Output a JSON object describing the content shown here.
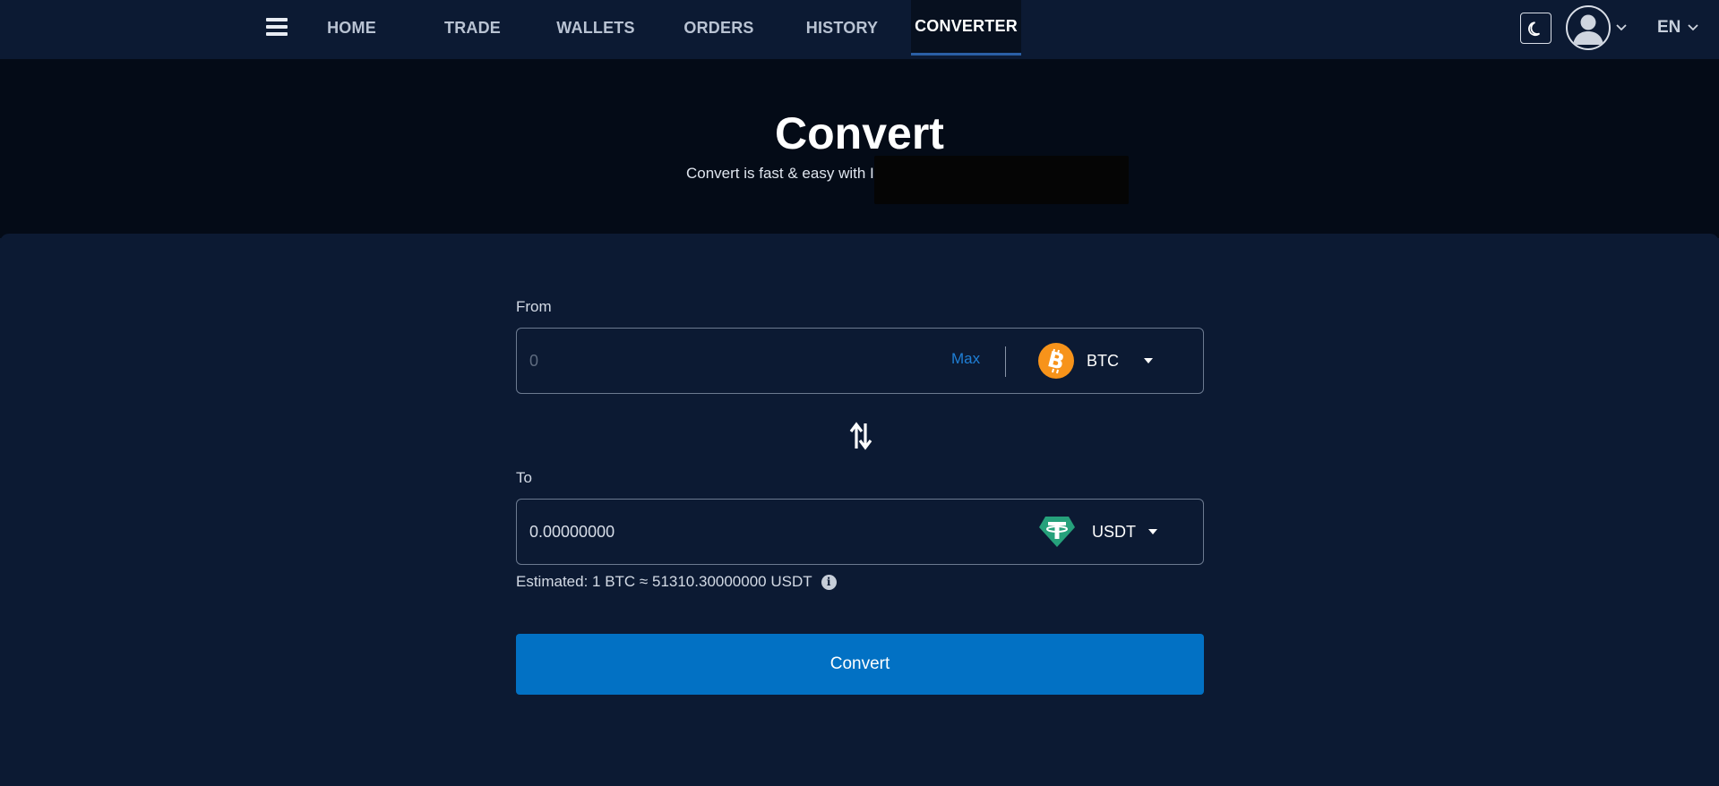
{
  "nav": {
    "items": [
      {
        "label": "HOME",
        "active": false
      },
      {
        "label": "TRADE",
        "active": false
      },
      {
        "label": "WALLETS",
        "active": false
      },
      {
        "label": "ORDERS",
        "active": false
      },
      {
        "label": "HISTORY",
        "active": false
      },
      {
        "label": "CONVERTER",
        "active": true
      }
    ],
    "language": "EN",
    "icons": {
      "menu": "hamburger-icon",
      "theme": "moon-icon",
      "profile": "user-avatar-icon"
    }
  },
  "hero": {
    "title": "Convert",
    "subtitle": "Convert is fast & easy with I"
  },
  "converter": {
    "from": {
      "label": "From",
      "value": "",
      "placeholder": "0",
      "max_label": "Max",
      "coin": "BTC",
      "coin_icon": "bitcoin-icon",
      "coin_color": "#f7931a"
    },
    "to": {
      "label": "To",
      "value": "0.00000000",
      "coin": "USDT",
      "coin_icon": "tether-icon",
      "coin_color": "#26a17b"
    },
    "estimate": "Estimated: 1 BTC ≈ 51310.30000000 USDT",
    "button_label": "Convert"
  },
  "colors": {
    "background": "#0c1a33",
    "hero_background": "#040b17",
    "accent": "#0271c4",
    "link": "#1f7fd6"
  }
}
